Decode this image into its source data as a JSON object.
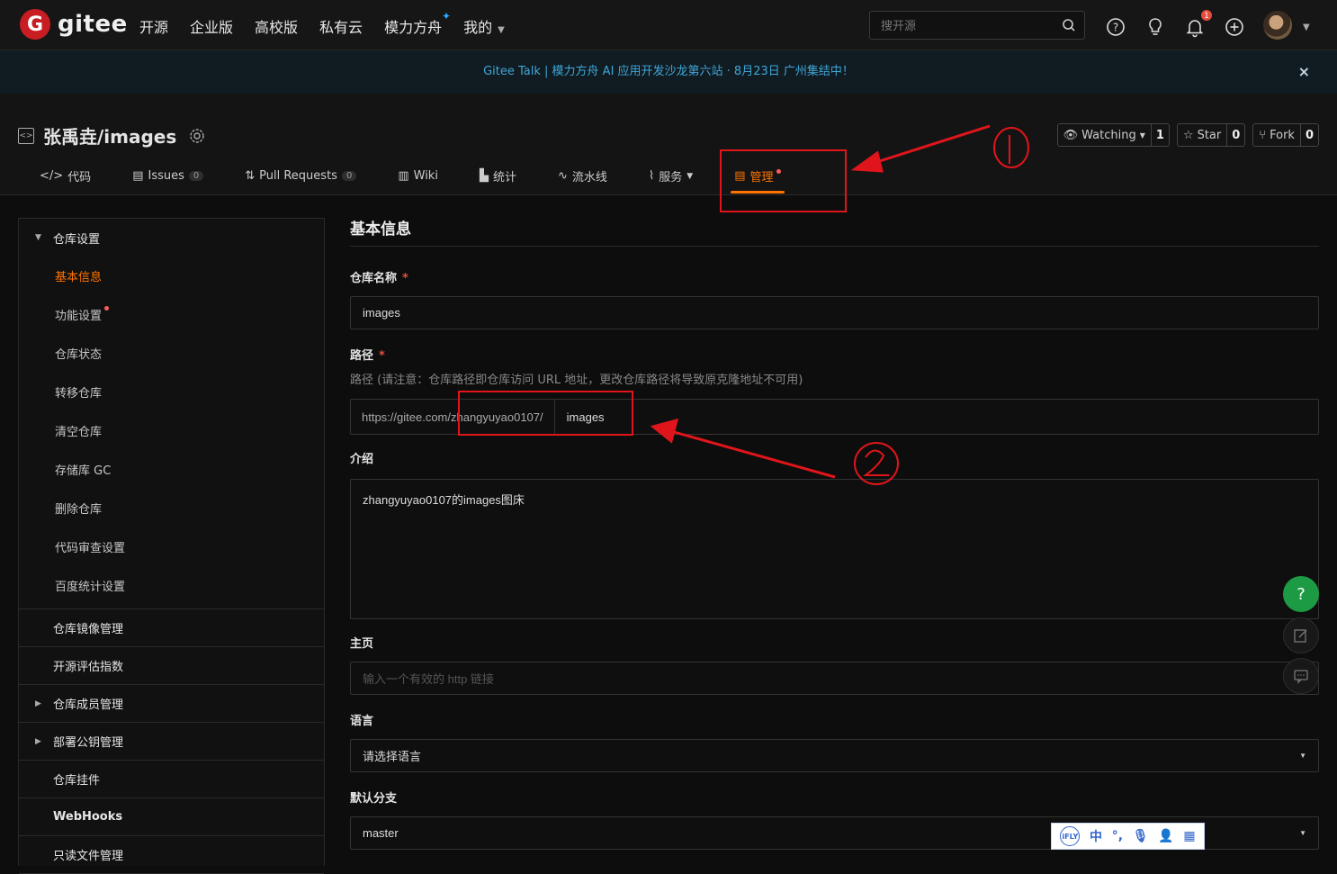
{
  "topbar": {
    "logo_text": "gitee",
    "nav": [
      {
        "label": "开源"
      },
      {
        "label": "企业版"
      },
      {
        "label": "高校版"
      },
      {
        "label": "私有云"
      },
      {
        "label": "模力方舟"
      },
      {
        "label": "我的"
      }
    ],
    "search_placeholder": "搜开源",
    "notification_count": "1"
  },
  "banner": {
    "text": "Gitee Talk | 模力方舟 AI 应用开发沙龙第六站 · 8月23日 广州集结中！",
    "close": "×"
  },
  "repo": {
    "title": "张禹垚/images",
    "actions": {
      "watch_label": "Watching",
      "watch_count": "1",
      "star_label": "Star",
      "star_count": "0",
      "fork_label": "Fork",
      "fork_count": "0"
    },
    "tabs": [
      {
        "label": "代码",
        "count": ""
      },
      {
        "label": "Issues",
        "count": "0"
      },
      {
        "label": "Pull Requests",
        "count": "0"
      },
      {
        "label": "Wiki",
        "count": ""
      },
      {
        "label": "统计",
        "count": ""
      },
      {
        "label": "流水线",
        "count": ""
      },
      {
        "label": "服务",
        "count": ""
      },
      {
        "label": "管理",
        "count": ""
      }
    ]
  },
  "sidebar": {
    "section_main": "仓库设置",
    "items": [
      {
        "label": "基本信息"
      },
      {
        "label": "功能设置"
      },
      {
        "label": "仓库状态"
      },
      {
        "label": "转移仓库"
      },
      {
        "label": "清空仓库"
      },
      {
        "label": "存储库 GC"
      },
      {
        "label": "删除仓库"
      },
      {
        "label": "代码审查设置"
      },
      {
        "label": "百度统计设置"
      }
    ],
    "sections": [
      {
        "label": "仓库镜像管理"
      },
      {
        "label": "开源评估指数"
      },
      {
        "label": "仓库成员管理"
      },
      {
        "label": "部署公钥管理"
      },
      {
        "label": "仓库挂件"
      },
      {
        "label": "WebHooks"
      },
      {
        "label": "只读文件管理"
      }
    ]
  },
  "form": {
    "heading": "基本信息",
    "name_label": "仓库名称",
    "name_value": "images",
    "required_mark": "*",
    "path_label": "路径",
    "path_hint": "路径 (请注意：仓库路径即仓库访问 URL 地址，更改仓库路径将导致原克隆地址不可用)",
    "path_prefix": "https://gitee.com/zhangyuyao0107/",
    "path_value": "images",
    "desc_label": "介绍",
    "desc_value": "zhangyuyao0107的images图床",
    "homepage_label": "主页",
    "homepage_placeholder": "输入一个有效的 http 链接",
    "language_label": "语言",
    "language_value": "请选择语言",
    "branch_label": "默认分支",
    "branch_value": "master"
  },
  "float": {
    "help": "?"
  },
  "ime": {
    "zh": "中"
  },
  "colors": {
    "accent": "#fe7300",
    "annotation": "#e0151b",
    "link": "#3ea6d8",
    "help_green": "#1d9b44"
  }
}
